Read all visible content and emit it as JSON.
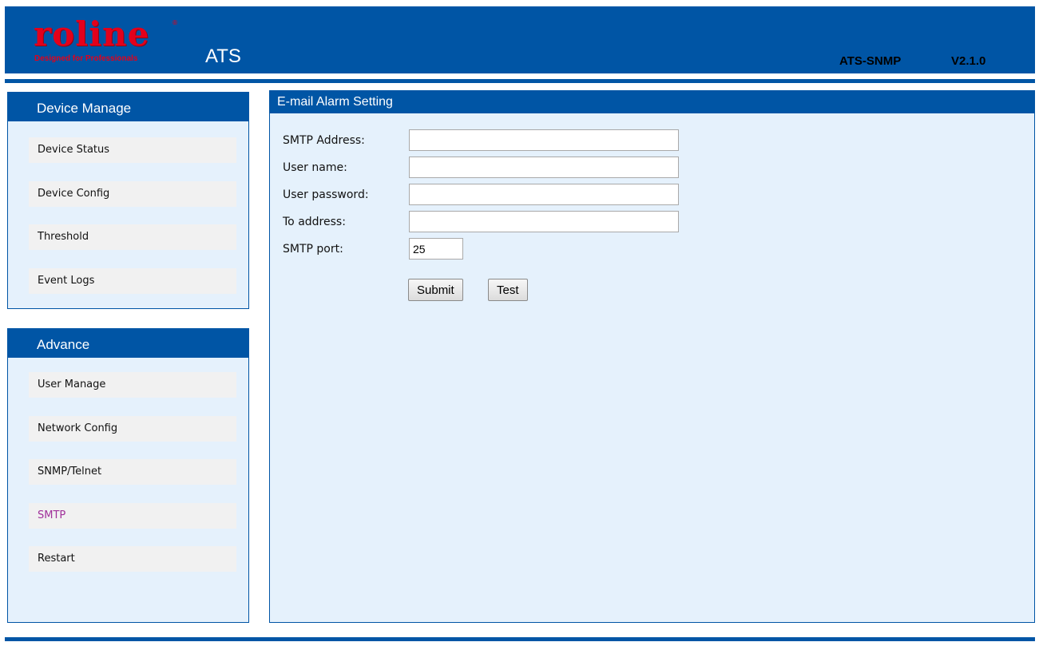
{
  "header": {
    "logo_text": "roline",
    "logo_tagline": "Designed for Professionals",
    "logo_reg": "®",
    "app_title": "ATS",
    "model": "ATS-SNMP",
    "version": "V2.1.0"
  },
  "colors": {
    "brand_blue": "#0055a5",
    "panel_bg": "#e5f1fc",
    "logo_red": "#e3001b",
    "active_link": "#a0309a"
  },
  "sidebar": {
    "device_manage": {
      "title": "Device Manage",
      "items": [
        {
          "label": "Device Status"
        },
        {
          "label": "Device Config"
        },
        {
          "label": "Threshold"
        },
        {
          "label": "Event Logs"
        }
      ]
    },
    "advance": {
      "title": "Advance",
      "items": [
        {
          "label": "User Manage"
        },
        {
          "label": "Network Config"
        },
        {
          "label": "SNMP/Telnet"
        },
        {
          "label": "SMTP"
        },
        {
          "label": "Restart"
        }
      ],
      "active_item": "SMTP"
    }
  },
  "main": {
    "title": "E-mail Alarm Setting",
    "fields": {
      "smtp_address": {
        "label": "SMTP Address:",
        "value": ""
      },
      "user_name": {
        "label": "User name:",
        "value": ""
      },
      "user_password": {
        "label": "User password:",
        "value": ""
      },
      "to_address": {
        "label": "To address:",
        "value": ""
      },
      "smtp_port": {
        "label": "SMTP port:",
        "value": "25"
      }
    },
    "buttons": {
      "submit": "Submit",
      "test": "Test"
    }
  }
}
